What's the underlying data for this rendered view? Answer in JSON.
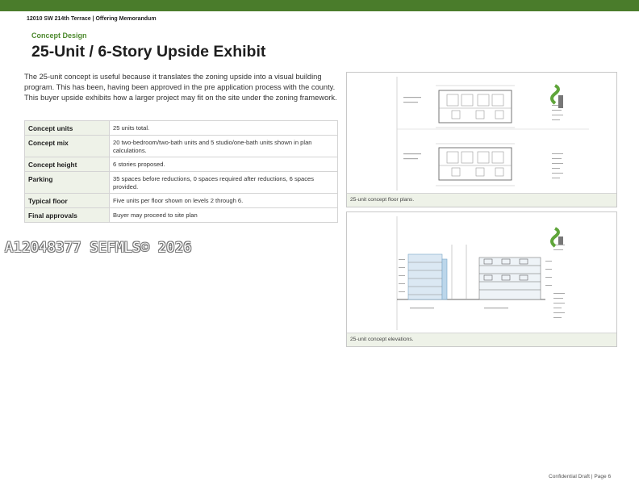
{
  "header": {
    "text": "12010 SW 214th Terrace | Offering Memorandum"
  },
  "section_label": "Concept Design",
  "title": "25-Unit / 6-Story Upside Exhibit",
  "intro": "The 25-unit concept is useful because it translates the zoning upside into a visual building program. This has been, having been approved in the pre application process with the county. This buyer upside exhibits how a larger project may fit on the site under the zoning framework.",
  "facts": [
    {
      "label": "Concept units",
      "value": "25 units total."
    },
    {
      "label": "Concept mix",
      "value": "20 two-bedroom/two-bath units and 5 studio/one-bath units shown in plan calculations."
    },
    {
      "label": "Concept height",
      "value": "6 stories proposed."
    },
    {
      "label": "Parking",
      "value": "35 spaces before reductions, 0 spaces required after reductions, 6 spaces provided."
    },
    {
      "label": "Typical floor",
      "value": "Five units per floor shown on levels 2 through 6."
    },
    {
      "label": "Final approvals",
      "value": "Buyer may proceed to site plan"
    }
  ],
  "watermark": "A12048377  SEFMLS© 2026",
  "figures": {
    "plans_caption": "25-unit concept floor plans.",
    "elevations_caption": "25-unit concept elevations."
  },
  "footer": "Confidential Draft | Page 6",
  "colors": {
    "brand_green": "#4a7c2b",
    "accent_green": "#4e8a2f",
    "table_label_bg": "#eef2e8"
  }
}
